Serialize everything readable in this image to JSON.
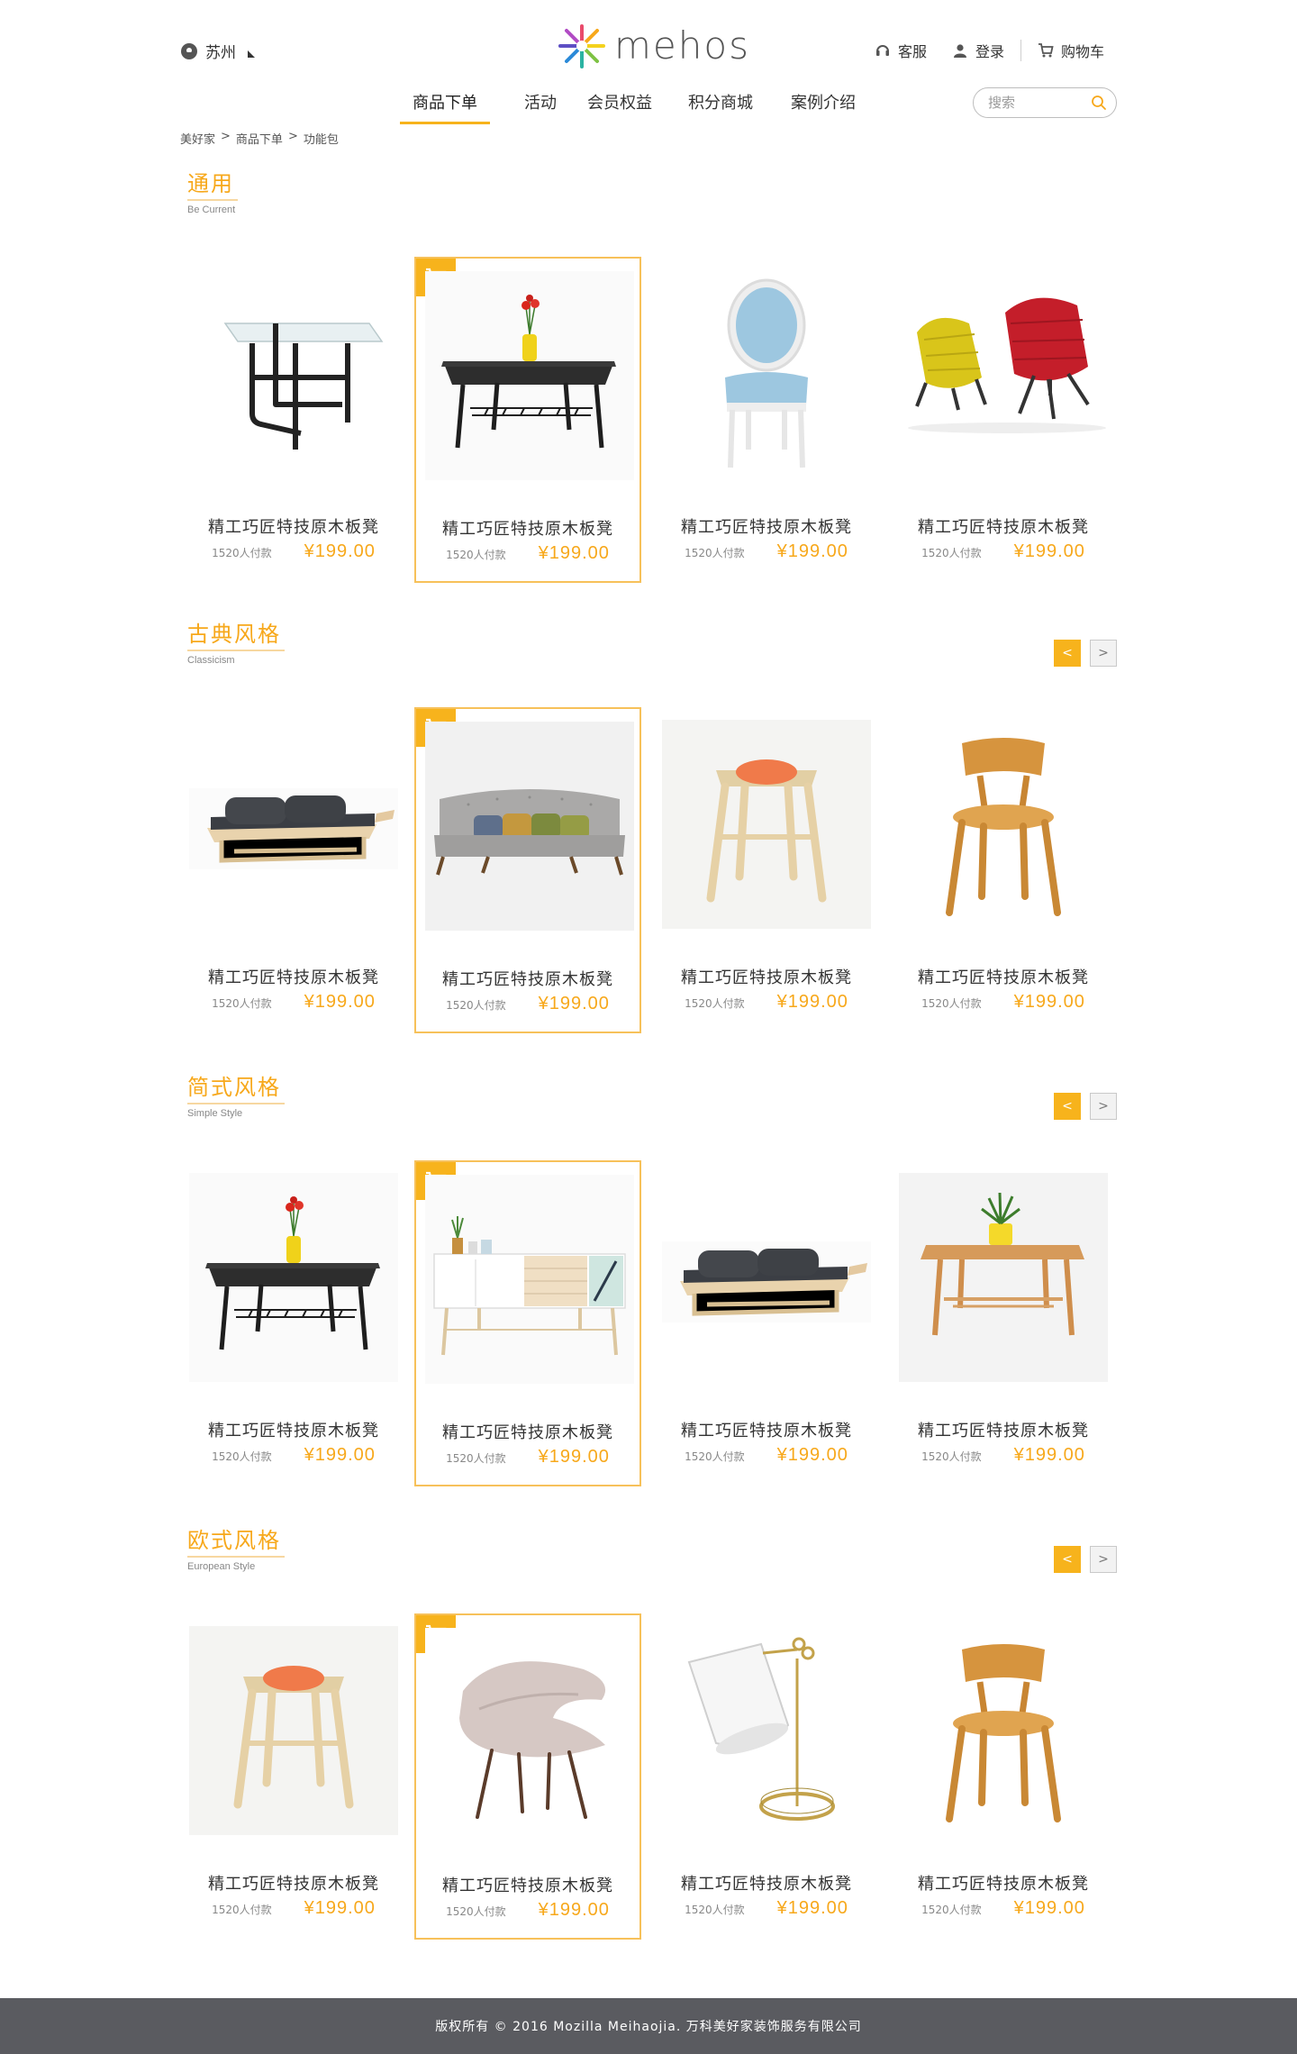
{
  "header": {
    "city": "苏州",
    "logo_text": "mehos",
    "links": {
      "service": "客服",
      "login": "登录",
      "cart": "购物车"
    },
    "search_placeholder": "搜索"
  },
  "nav": [
    {
      "label": "商品下单",
      "active": true
    },
    {
      "label": "活动",
      "active": false
    },
    {
      "label": "会员权益",
      "active": false
    },
    {
      "label": "积分商城",
      "active": false
    },
    {
      "label": "案例介绍",
      "active": false
    }
  ],
  "breadcrumb": [
    "美好家",
    "商品下单",
    "功能包"
  ],
  "breadcrumb_sep": ">",
  "colors": {
    "accent": "#f7a81b",
    "badge": "#f7b31c",
    "card_border": "#f7c15a",
    "footer_bg": "#5a5b60"
  },
  "sections": [
    {
      "title": "通用",
      "subtitle": "Be Current",
      "pager": false,
      "products": [
        {
          "name": "精工巧匠特技原木板凳",
          "sold": "1520人付款",
          "price": "¥199.00",
          "image": "glass-table"
        },
        {
          "name": "精工巧匠特技原木板凳",
          "sold": "1520人付款",
          "price": "¥199.00",
          "image": "coffee-table-vase",
          "highlight": true
        },
        {
          "name": "精工巧匠特技原木板凳",
          "sold": "1520人付款",
          "price": "¥199.00",
          "image": "blue-medallion-chair"
        },
        {
          "name": "精工巧匠特技原木板凳",
          "sold": "1520人付款",
          "price": "¥199.00",
          "image": "lounge-chairs"
        }
      ]
    },
    {
      "title": "古典风格",
      "subtitle": "Classicism",
      "pager": true,
      "products": [
        {
          "name": "精工巧匠特技原木板凳",
          "sold": "1520人付款",
          "price": "¥199.00",
          "image": "daybed"
        },
        {
          "name": "精工巧匠特技原木板凳",
          "sold": "1520人付款",
          "price": "¥199.00",
          "image": "grey-sofa",
          "highlight": true
        },
        {
          "name": "精工巧匠特技原木板凳",
          "sold": "1520人付款",
          "price": "¥199.00",
          "image": "wood-stool"
        },
        {
          "name": "精工巧匠特技原木板凳",
          "sold": "1520人付款",
          "price": "¥199.00",
          "image": "wood-chair"
        }
      ]
    },
    {
      "title": "简式风格",
      "subtitle": "Simple Style",
      "pager": true,
      "products": [
        {
          "name": "精工巧匠特技原木板凳",
          "sold": "1520人付款",
          "price": "¥199.00",
          "image": "coffee-table-vase"
        },
        {
          "name": "精工巧匠特技原木板凳",
          "sold": "1520人付款",
          "price": "¥199.00",
          "image": "sideboard",
          "highlight": true
        },
        {
          "name": "精工巧匠特技原木板凳",
          "sold": "1520人付款",
          "price": "¥199.00",
          "image": "daybed"
        },
        {
          "name": "精工巧匠特技原木板凳",
          "sold": "1520人付款",
          "price": "¥199.00",
          "image": "wood-side-table"
        }
      ]
    },
    {
      "title": "欧式风格",
      "subtitle": "European Style",
      "pager": true,
      "products": [
        {
          "name": "精工巧匠特技原木板凳",
          "sold": "1520人付款",
          "price": "¥199.00",
          "image": "wood-stool"
        },
        {
          "name": "精工巧匠特技原木板凳",
          "sold": "1520人付款",
          "price": "¥199.00",
          "image": "pink-shell-chair",
          "highlight": true
        },
        {
          "name": "精工巧匠特技原木板凳",
          "sold": "1520人付款",
          "price": "¥199.00",
          "image": "white-lamp"
        },
        {
          "name": "精工巧匠特技原木板凳",
          "sold": "1520人付款",
          "price": "¥199.00",
          "image": "wood-chair"
        }
      ]
    }
  ],
  "pager_labels": {
    "prev": "<",
    "next": ">"
  },
  "footer": {
    "copyright": "版权所有 © 2016 Mozilla Meihaojia. 万科美好家装饰服务有限公司"
  }
}
